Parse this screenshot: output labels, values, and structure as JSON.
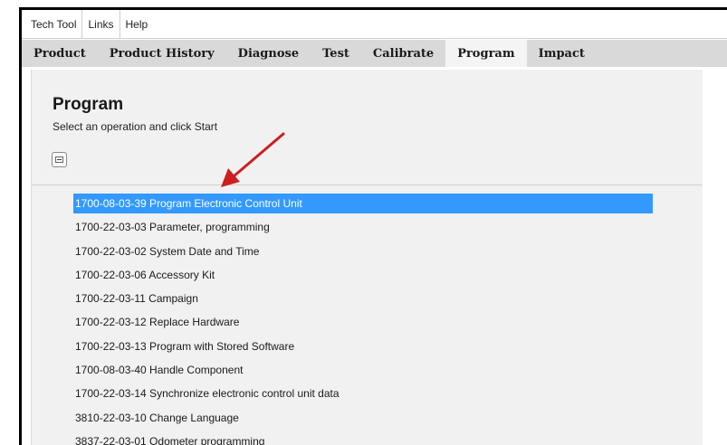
{
  "menubar": {
    "items": [
      {
        "label": "Tech Tool"
      },
      {
        "label": "Links"
      },
      {
        "label": "Help"
      }
    ]
  },
  "tabs": [
    {
      "label": "Product",
      "active": false
    },
    {
      "label": "Product History",
      "active": false
    },
    {
      "label": "Diagnose",
      "active": false
    },
    {
      "label": "Test",
      "active": false
    },
    {
      "label": "Calibrate",
      "active": false
    },
    {
      "label": "Program",
      "active": true
    },
    {
      "label": "Impact",
      "active": false
    }
  ],
  "page": {
    "title": "Program",
    "subtitle": "Select an operation and click Start"
  },
  "operations": [
    {
      "label": "1700-08-03-39 Program Electronic Control Unit",
      "selected": true
    },
    {
      "label": "1700-22-03-03 Parameter, programming",
      "selected": false
    },
    {
      "label": "1700-22-03-02 System Date and Time",
      "selected": false
    },
    {
      "label": "1700-22-03-06 Accessory Kit",
      "selected": false
    },
    {
      "label": "1700-22-03-11 Campaign",
      "selected": false
    },
    {
      "label": "1700-22-03-12 Replace Hardware",
      "selected": false
    },
    {
      "label": "1700-22-03-13 Program with Stored Software",
      "selected": false
    },
    {
      "label": "1700-08-03-40 Handle Component",
      "selected": false
    },
    {
      "label": "1700-22-03-14 Synchronize electronic control unit data",
      "selected": false
    },
    {
      "label": "3810-22-03-10 Change Language",
      "selected": false
    },
    {
      "label": "3837-22-03-01 Odometer programming",
      "selected": false
    }
  ],
  "colors": {
    "selection": "#3399ff",
    "annotation_arrow": "#cc1f1f",
    "tab_bar": "#d9d9d9",
    "panel": "#f1f1f1"
  }
}
